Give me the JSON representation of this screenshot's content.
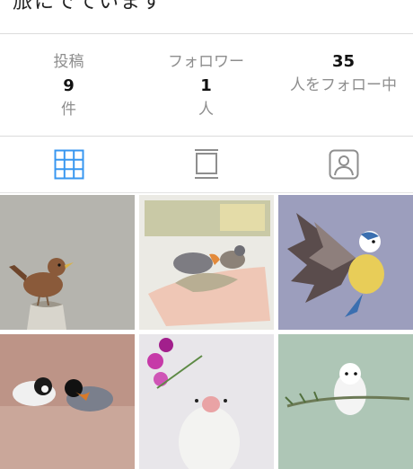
{
  "header": {
    "top_text": "旅にでています"
  },
  "stats": [
    {
      "label": "投稿",
      "value": "9",
      "unit": "件"
    },
    {
      "label": "フォロワー",
      "value": "1",
      "unit": "人"
    },
    {
      "value": "35",
      "unit": "人をフォロー中"
    }
  ],
  "tabs": [
    {
      "icon": "grid-icon",
      "active": true
    },
    {
      "icon": "feed-icon",
      "active": false
    },
    {
      "icon": "tagged-person-icon",
      "active": false
    }
  ],
  "colors": {
    "accent": "#3897f0",
    "muted": "#8e8e8e",
    "divider": "#dcdcdc"
  },
  "photos": [
    {
      "subject": "wren on stump"
    },
    {
      "subject": "finches eating from hand"
    },
    {
      "subject": "blue tit in flight"
    },
    {
      "subject": "two tits on branch"
    },
    {
      "subject": "java sparrow with flowers"
    },
    {
      "subject": "long-tailed tit on twig"
    }
  ]
}
